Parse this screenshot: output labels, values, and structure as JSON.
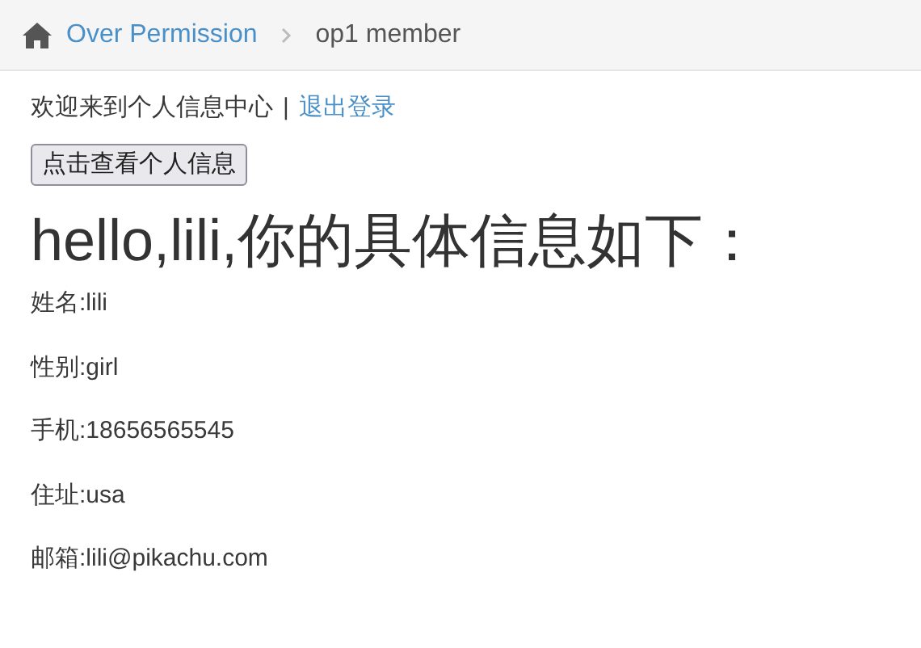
{
  "breadcrumb": [
    {
      "label": "Over Permission",
      "kind": "link"
    },
    {
      "label": "op1 member",
      "kind": "current"
    }
  ],
  "welcome": {
    "text": "欢迎来到个人信息中心",
    "separator": "|",
    "logout": "退出登录"
  },
  "button": "点击查看个人信息",
  "heading": "hello,lili,你的具体信息如下：",
  "fields": [
    "姓名:lili",
    "性别:girl",
    "手机:18656565545",
    "住址:usa",
    "邮箱:lili@pikachu.com"
  ]
}
